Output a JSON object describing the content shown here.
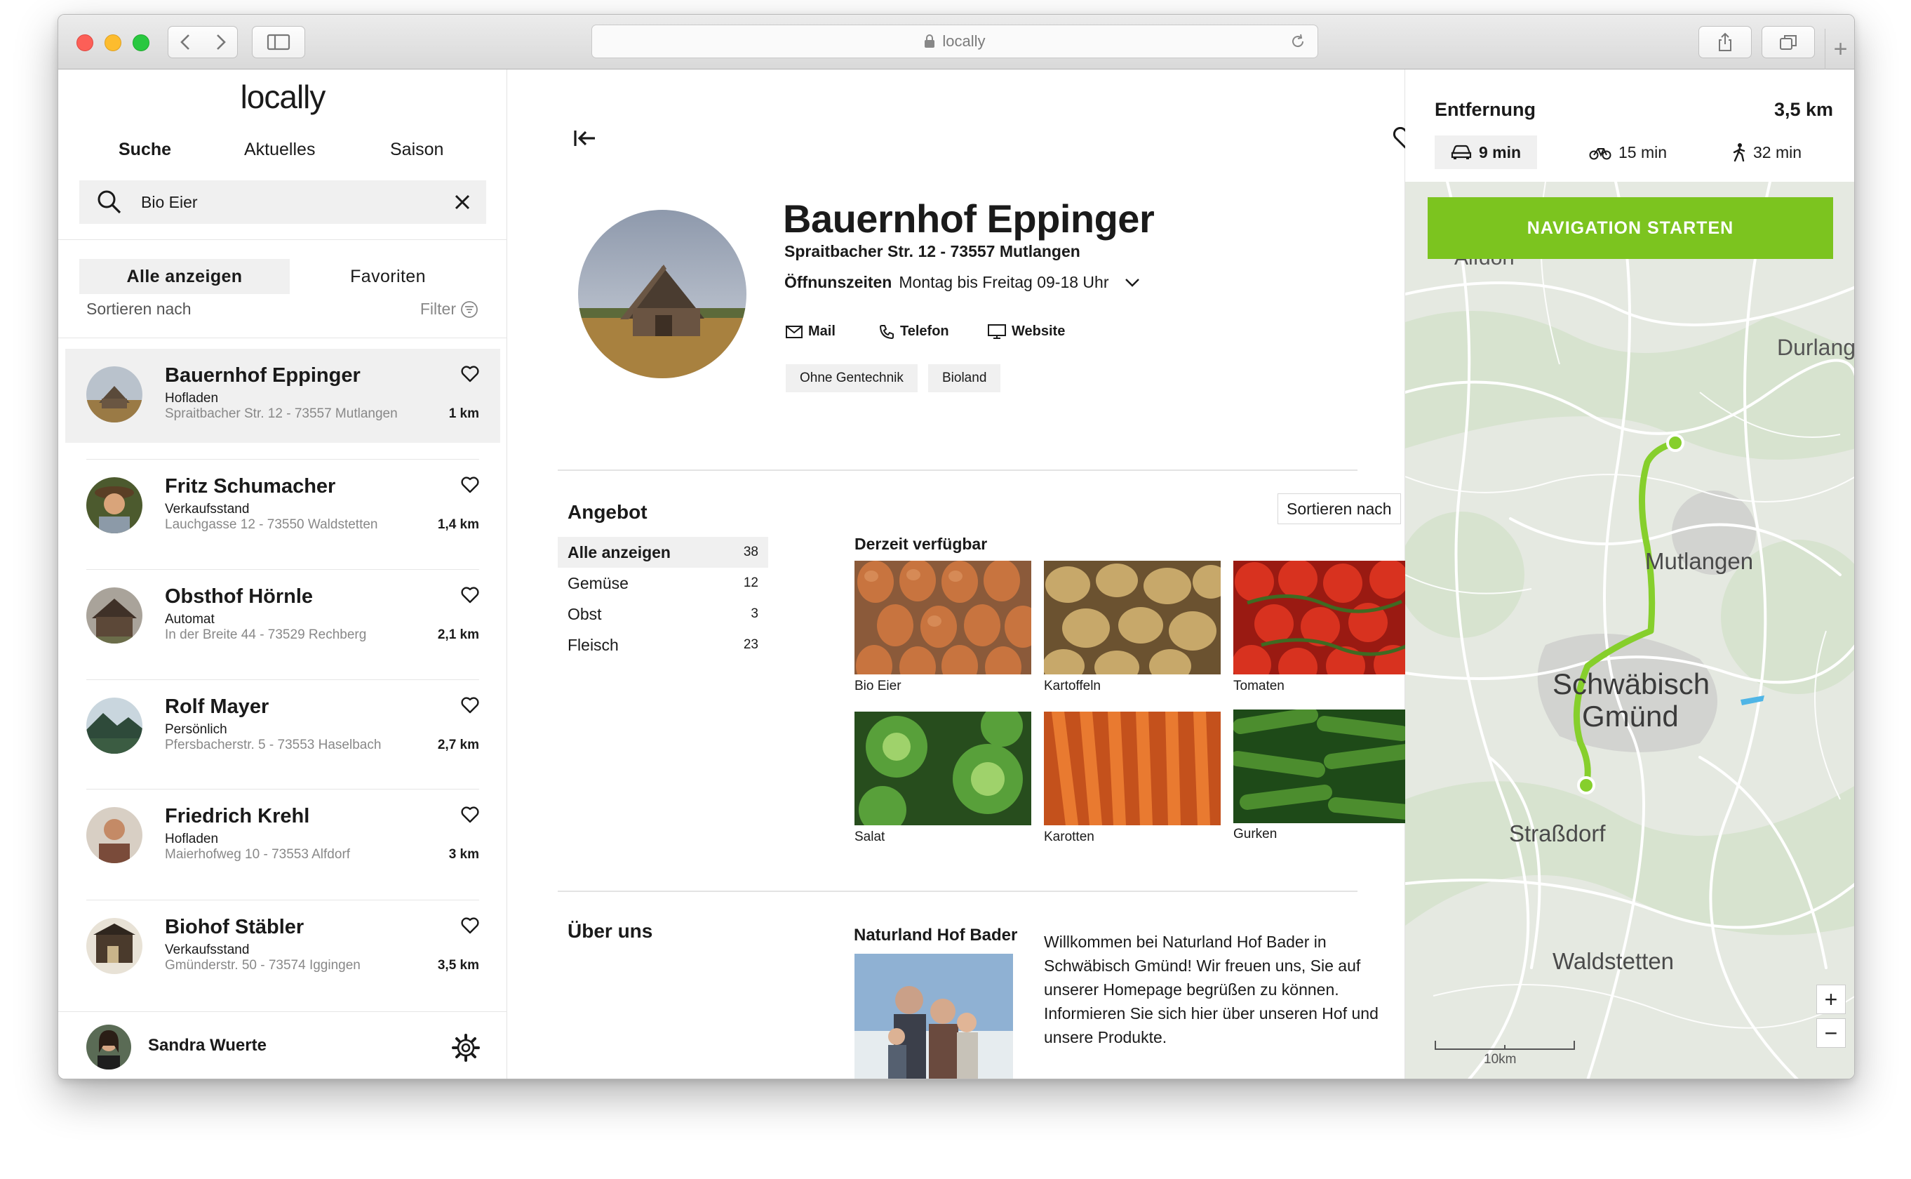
{
  "browser": {
    "url": "locally"
  },
  "app": {
    "logo": "locally",
    "nav": [
      "Suche",
      "Aktuelles",
      "Saison"
    ],
    "search": {
      "value": "Bio Eier"
    },
    "toggle": {
      "all": "Alle anzeigen",
      "favorites": "Favoriten"
    },
    "sort_label": "Sortieren nach",
    "filter_label": "Filter",
    "list": [
      {
        "name": "Bauernhof Eppinger",
        "type": "Hofladen",
        "address": "Spraitbacher Str. 12 - 73557 Mutlangen",
        "distance": "1 km"
      },
      {
        "name": "Fritz Schumacher",
        "type": "Verkaufsstand",
        "address": "Lauchgasse 12 - 73550 Waldstetten",
        "distance": "1,4 km"
      },
      {
        "name": "Obsthof Hörnle",
        "type": "Automat",
        "address": "In der Breite 44 - 73529 Rechberg",
        "distance": "2,1 km"
      },
      {
        "name": "Rolf Mayer",
        "type": "Persönlich",
        "address": "Pfersbacherstr. 5 - 73553 Haselbach",
        "distance": "2,7 km"
      },
      {
        "name": "Friedrich Krehl",
        "type": "Hofladen",
        "address": "Maierhofweg 10 - 73553 Alfdorf",
        "distance": "3 km"
      },
      {
        "name": "Biohof Stäbler",
        "type": "Verkaufsstand",
        "address": "Gmünderstr. 50 - 73574 Iggingen",
        "distance": "3,5 km"
      }
    ],
    "user": {
      "name": "Sandra Wuerte"
    }
  },
  "detail": {
    "name": "Bauernhof Eppinger",
    "address": "Spraitbacher Str. 12 - 73557 Mutlangen",
    "hours_label": "Öffnunszeiten",
    "hours_value": "Montag bis Freitag 09-18 Uhr",
    "contacts": {
      "mail": "Mail",
      "phone": "Telefon",
      "web": "Website"
    },
    "tags": [
      "Ohne Gentechnik",
      "Bioland"
    ],
    "offer_title": "Angebot",
    "offer_sort": "Sortieren nach",
    "categories": [
      {
        "label": "Alle anzeigen",
        "count": "38"
      },
      {
        "label": "Gemüse",
        "count": "12"
      },
      {
        "label": "Obst",
        "count": "3"
      },
      {
        "label": "Fleisch",
        "count": "23"
      }
    ],
    "available_title": "Derzeit verfügbar",
    "products": [
      "Bio Eier",
      "Kartoffeln",
      "Tomaten",
      "Salat",
      "Karotten",
      "Gurken"
    ],
    "about_title": "Über uns",
    "about_heading": "Naturland Hof Bader",
    "about_text": "Willkommen bei Naturland Hof Bader in Schwäbisch Gmünd! Wir freuen uns, Sie auf unserer Homepage begrüßen zu können. Informieren Sie sich hier über unseren Hof und unsere Produkte."
  },
  "distance": {
    "label": "Entfernung",
    "value": "3,5 km",
    "car": "9 min",
    "bike": "15 min",
    "walk": "32 min",
    "nav_button": "NAVIGATION STARTEN"
  },
  "map": {
    "places": [
      "Alfdorf",
      "Durlang",
      "Mutlangen",
      "Schwäbisch",
      "Gmünd",
      "Straßdorf",
      "Waldstetten"
    ],
    "scale": "10km",
    "zoom_in": "+",
    "zoom_out": "−"
  },
  "colors": {
    "accent": "#7cc41f",
    "route": "#86cf2c"
  }
}
